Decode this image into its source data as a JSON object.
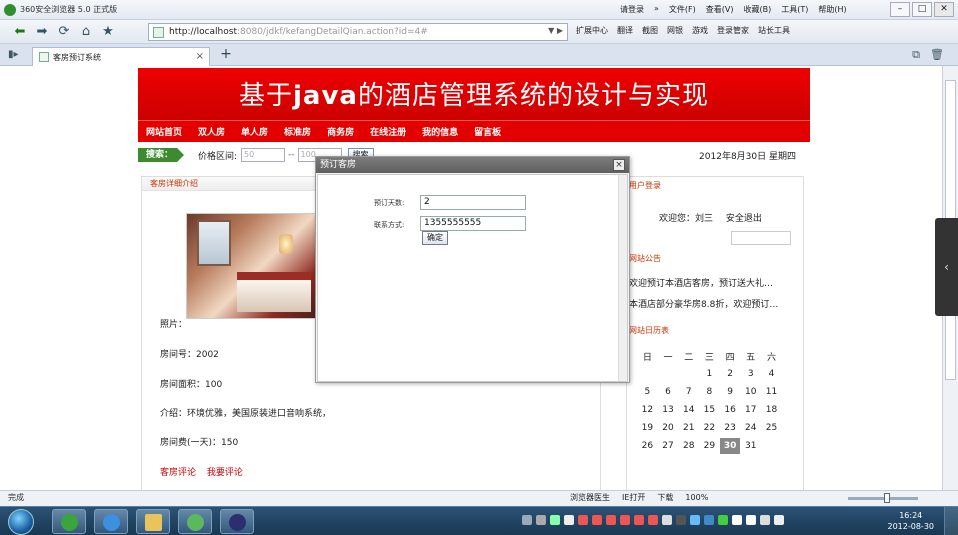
{
  "window": {
    "title": "360安全浏览器 5.0 正式版",
    "menus": [
      "请登录",
      "»",
      "文件(F)",
      "查看(V)",
      "收藏(B)",
      "工具(T)",
      "帮助(H)"
    ]
  },
  "addressbar": {
    "host": "http://localhost",
    "rest": ":8080/jdkf/kefangDetailQian.action?id=4#"
  },
  "toolbar": {
    "items": [
      "扩展中心",
      "翻译",
      "截图",
      "网银",
      "游戏",
      "登录管家",
      "站长工具"
    ]
  },
  "tab": {
    "title": "客房预订系统"
  },
  "site": {
    "banner": "基于java的酒店管理系统的设计与实现",
    "nav": [
      "网站首页",
      "双人房",
      "单人房",
      "标准房",
      "商务房",
      "在线注册",
      "我的信息",
      "留言板"
    ],
    "search": {
      "tag": "搜索：",
      "price_label": "价格区间:",
      "price_min_placeholder": "50",
      "price_max_placeholder": "100",
      "button": "搜索"
    },
    "date": "2012年8月30日 星期四"
  },
  "room": {
    "panel_title": "客房详细介绍",
    "photo_label": "照片：",
    "room_no": "房间号：2002",
    "area": "房间面积：100",
    "intro": "介绍：环境优雅，美国原装进口音响系统，",
    "price": "房间费(一天)：150",
    "links": [
      "客房评论",
      "我要评论"
    ]
  },
  "sidebar": {
    "login_title": "用户登录",
    "welcome": "欢迎您：刘三",
    "logout": "安全退出",
    "notice_title": "网站公告",
    "notices": [
      "欢迎预订本酒店客房，预订送大礼…",
      "本酒店部分豪华房8.8折，欢迎预订…"
    ],
    "calendar_title": "网站日历表",
    "weekdays": [
      "日",
      "一",
      "二",
      "三",
      "四",
      "五",
      "六"
    ],
    "weeks": [
      [
        "",
        "",
        "",
        "1",
        "2",
        "3",
        "4"
      ],
      [
        "5",
        "6",
        "7",
        "8",
        "9",
        "10",
        "11"
      ],
      [
        "12",
        "13",
        "14",
        "15",
        "16",
        "17",
        "18"
      ],
      [
        "19",
        "20",
        "21",
        "22",
        "23",
        "24",
        "25"
      ],
      [
        "26",
        "27",
        "28",
        "29",
        "30",
        "31",
        ""
      ]
    ],
    "today": "30"
  },
  "modal": {
    "title": "预订客房",
    "close": "×",
    "days_label": "预订天数:",
    "days_value": "2",
    "contact_label": "联系方式:",
    "contact_value": "1355555555",
    "confirm": "确定"
  },
  "statusbar": {
    "text": "完成",
    "items": [
      "浏览器医生",
      "IE打开",
      "下载",
      "100%"
    ]
  },
  "taskbar": {
    "time": "16:24",
    "date": "2012-08-30"
  },
  "colors": {
    "banner_red": "#e00000",
    "nav_red": "#e20000",
    "search_green": "#3d8a2f",
    "link_red": "#cc0000"
  }
}
